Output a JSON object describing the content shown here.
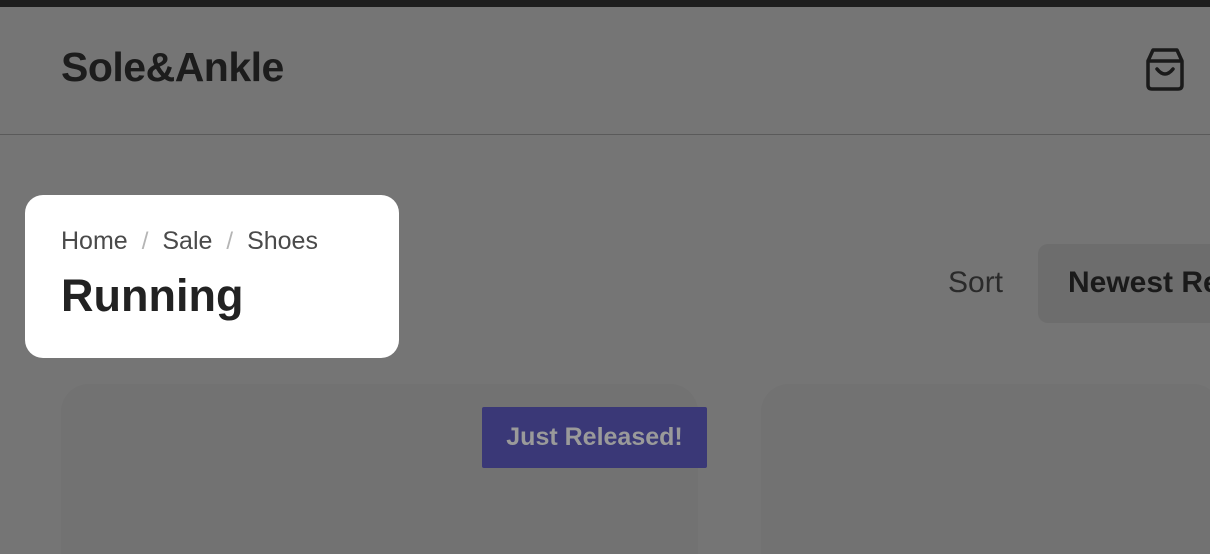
{
  "header": {
    "logo": "Sole&Ankle",
    "cart_icon": "shopping-bag-icon"
  },
  "breadcrumb": {
    "items": [
      "Home",
      "Sale",
      "Shoes"
    ],
    "separator": "/"
  },
  "page": {
    "title": "Running"
  },
  "sort": {
    "label": "Sort",
    "selected": "Newest Releases"
  },
  "products": [
    {
      "badge": "Just Released!"
    }
  ],
  "colors": {
    "badge_bg": "#3a3877",
    "overlay": "#757575",
    "spotlight_bg": "#ffffff"
  }
}
